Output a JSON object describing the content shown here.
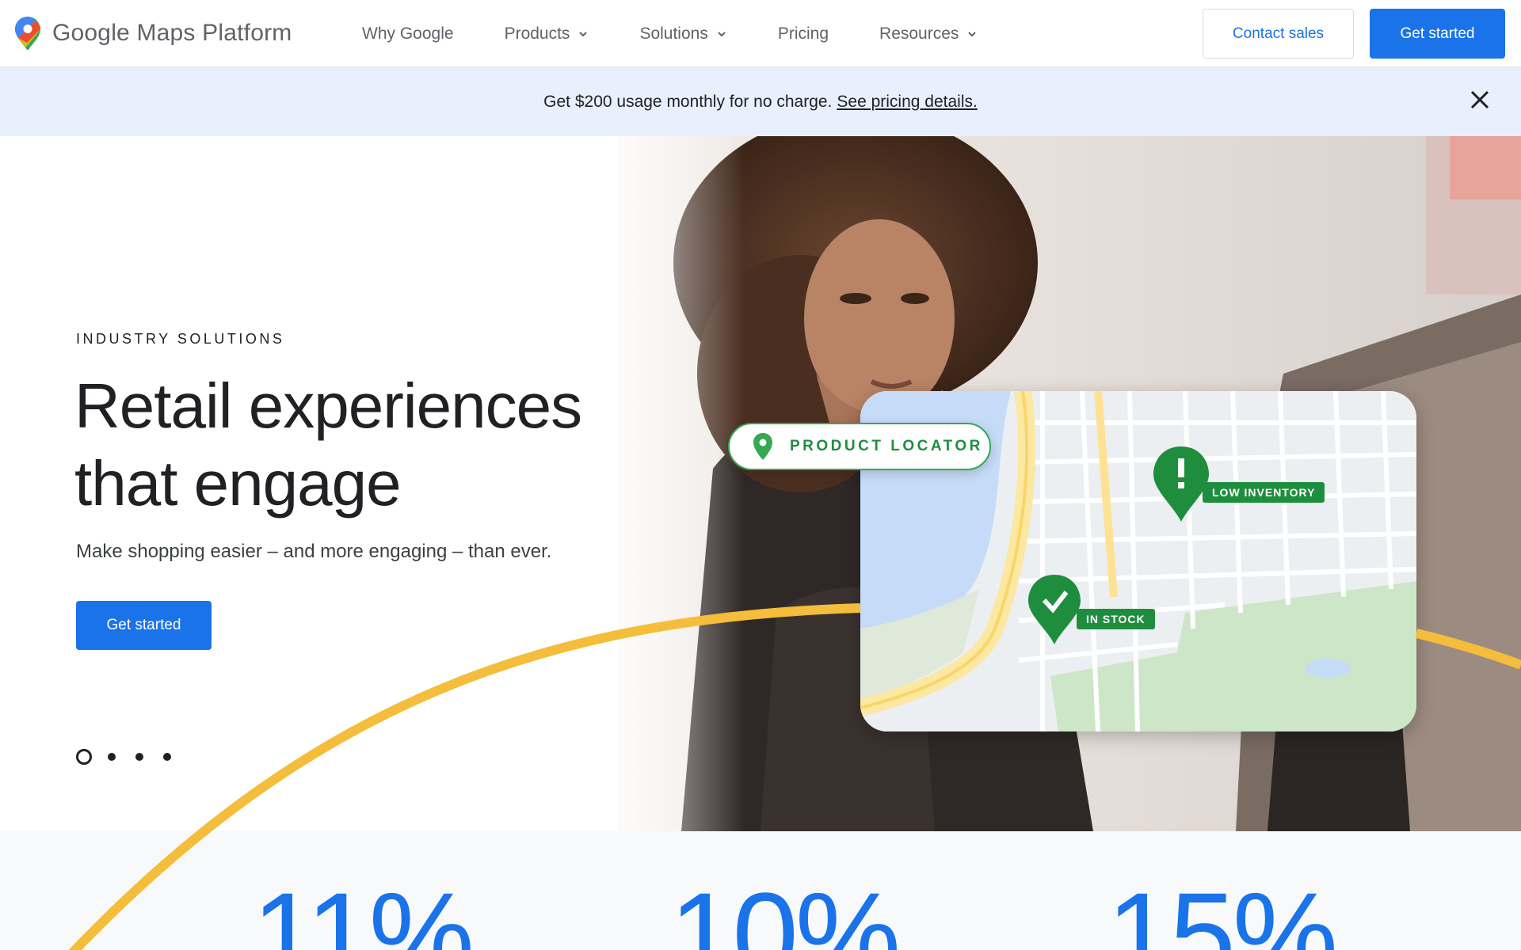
{
  "header": {
    "logo_text": "Google Maps Platform",
    "nav": [
      {
        "label": "Why Google",
        "dropdown": false
      },
      {
        "label": "Products",
        "dropdown": true
      },
      {
        "label": "Solutions",
        "dropdown": true
      },
      {
        "label": "Pricing",
        "dropdown": false
      },
      {
        "label": "Resources",
        "dropdown": true
      }
    ],
    "contact_label": "Contact sales",
    "get_started_label": "Get started"
  },
  "banner": {
    "text": "Get $200 usage monthly for no charge.",
    "link": "See pricing details."
  },
  "hero": {
    "eyebrow": "INDUSTRY SOLUTIONS",
    "title_line1": "Retail experiences",
    "title_line2": "that engage",
    "subtitle": "Make shopping easier – and more engaging – than ever.",
    "cta": "Get started",
    "carousel_active_index": 0,
    "carousel_count": 4
  },
  "map_overlay": {
    "pill_label": "PRODUCT LOCATOR",
    "tag_low": "LOW INVENTORY",
    "tag_stock": "IN STOCK"
  },
  "stats": [
    "11%",
    "10%",
    "15%"
  ],
  "colors": {
    "primary": "#1a73e8",
    "banner_bg": "#e8f0fe",
    "arc": "#f4bd3b",
    "green": "#1e8e3e"
  }
}
